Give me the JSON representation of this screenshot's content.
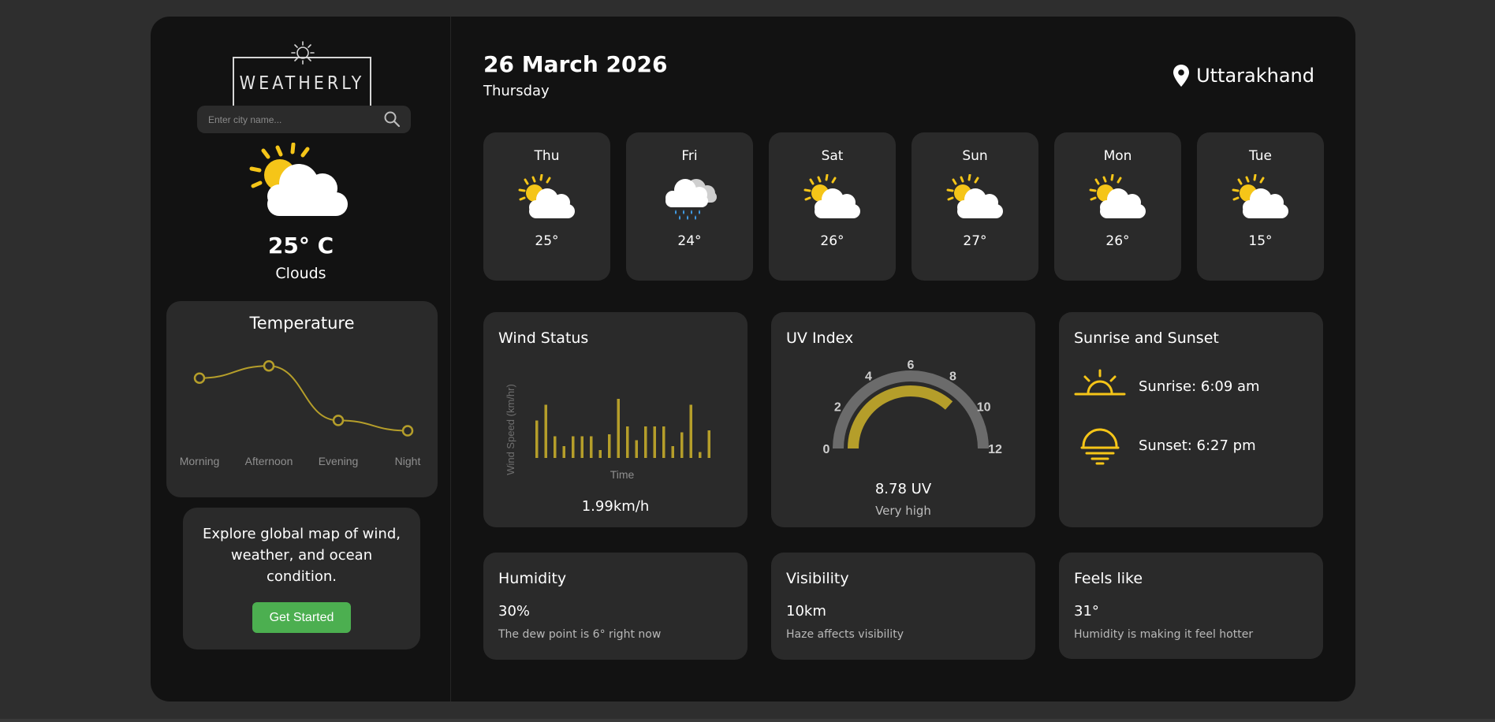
{
  "sidebar": {
    "logo_text": "WEATHERLY",
    "search": {
      "placeholder": "Enter city name..."
    },
    "current": {
      "icon": "sun-behind-cloud-icon",
      "temperature": "25° C",
      "condition": "Clouds"
    },
    "temperature_card": {
      "title": "Temperature",
      "chart_data": {
        "type": "line",
        "categories": [
          "Morning",
          "Afternoon",
          "Evening",
          "Night"
        ],
        "values": [
          25.0,
          26.3,
          20.5,
          19.4
        ],
        "ylim": [
          16,
          29
        ],
        "grid": false,
        "color": "#b59e2a"
      }
    },
    "explore": {
      "text": "Explore global map of wind, weather, and ocean condition.",
      "button_label": "Get Started",
      "button_color": "#4caf50"
    }
  },
  "header": {
    "date": "26 March 2026",
    "weekday": "Thursday",
    "location": "Uttarakhand"
  },
  "forecast": [
    {
      "day": "Thu",
      "temp": "25°",
      "icon": "partly-cloudy-icon"
    },
    {
      "day": "Fri",
      "temp": "24°",
      "icon": "rain-cloud-icon"
    },
    {
      "day": "Sat",
      "temp": "26°",
      "icon": "partly-cloudy-icon"
    },
    {
      "day": "Sun",
      "temp": "27°",
      "icon": "partly-cloudy-icon"
    },
    {
      "day": "Mon",
      "temp": "26°",
      "icon": "partly-cloudy-icon"
    },
    {
      "day": "Tue",
      "temp": "15°",
      "icon": "partly-cloudy-icon"
    }
  ],
  "wind": {
    "title": "Wind Status",
    "value": "1.99km/h",
    "chart_data": {
      "type": "bar",
      "xlabel": "Time",
      "ylabel": "Wind Speed (km/hr)",
      "values": [
        1.9,
        2.7,
        1.1,
        0.6,
        1.1,
        1.1,
        1.1,
        0.4,
        1.2,
        3.0,
        1.6,
        0.9,
        1.6,
        1.6,
        1.6,
        0.6,
        1.3,
        2.7,
        0.3,
        1.4
      ],
      "ylim": [
        0,
        4
      ],
      "color": "#b59e2a"
    }
  },
  "uv": {
    "title": "UV Index",
    "value": "8.78 UV",
    "label": "Very high",
    "scale_ticks": [
      "0",
      "2",
      "4",
      "6",
      "8",
      "10",
      "12"
    ],
    "chart_data": {
      "type": "gauge",
      "value": 8.78,
      "min": 0,
      "max": 12,
      "color": "#b59e2a",
      "track_color": "#6b6b6b"
    }
  },
  "sun": {
    "title": "Sunrise and Sunset",
    "sunrise": "Sunrise: 6:09 am",
    "sunset": "Sunset: 6:27 pm",
    "color": "#f5c518"
  },
  "humidity": {
    "title": "Humidity",
    "value": "30%",
    "desc": "The dew point is 6° right now"
  },
  "visibility": {
    "title": "Visibility",
    "value": "10km",
    "desc": "Haze affects visibility"
  },
  "feels": {
    "title": "Feels like",
    "value": "31°",
    "desc": "Humidity is making it feel hotter"
  }
}
